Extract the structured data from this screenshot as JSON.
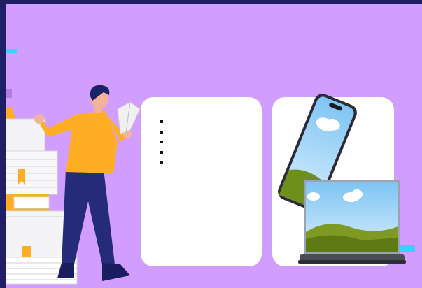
{
  "slide": {
    "background_color": "#d19dff",
    "frame_color": "#1f1f66",
    "accent_colors": [
      "#2bd9ff",
      "#ffad23"
    ]
  },
  "text_card": {
    "bullets": [
      {
        "text": ""
      },
      {
        "text": ""
      },
      {
        "text": ""
      },
      {
        "text": ""
      },
      {
        "text": ""
      }
    ]
  },
  "illustrations": {
    "left": "person-reading-with-book-stacks",
    "right": "smartphone-and-laptop-devices"
  }
}
